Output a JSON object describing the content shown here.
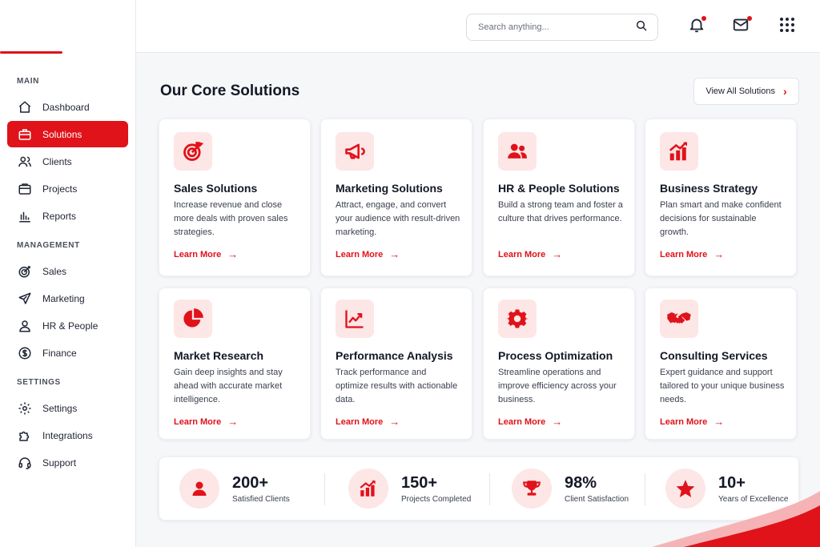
{
  "colors": {
    "accent": "#e0121a",
    "accent_soft": "#fde6e6"
  },
  "search": {
    "placeholder": "Search anything..."
  },
  "sidebar": {
    "sections": [
      {
        "title": "MAIN",
        "items": [
          {
            "label": "Dashboard",
            "icon": "home-icon"
          },
          {
            "label": "Solutions",
            "icon": "briefcase-icon",
            "active": true
          },
          {
            "label": "Clients",
            "icon": "users-icon"
          },
          {
            "label": "Projects",
            "icon": "folder-icon"
          },
          {
            "label": "Reports",
            "icon": "bar-chart-icon"
          }
        ]
      },
      {
        "title": "MANAGEMENT",
        "items": [
          {
            "label": "Sales",
            "icon": "target-icon"
          },
          {
            "label": "Marketing",
            "icon": "send-icon"
          },
          {
            "label": "HR & People",
            "icon": "user-icon"
          },
          {
            "label": "Finance",
            "icon": "dollar-icon"
          }
        ]
      },
      {
        "title": "SETTINGS",
        "items": [
          {
            "label": "Settings",
            "icon": "gear-icon"
          },
          {
            "label": "Integrations",
            "icon": "puzzle-icon"
          },
          {
            "label": "Support",
            "icon": "headset-icon"
          }
        ]
      }
    ]
  },
  "main": {
    "title": "Our Core Solutions",
    "view_all": "View All Solutions",
    "learn_more": "Learn More",
    "cards": [
      {
        "title": "Sales Solutions",
        "desc": "Increase revenue and close more deals with proven sales strategies.",
        "icon": "target-icon"
      },
      {
        "title": "Marketing Solutions",
        "desc": "Attract, engage, and convert your audience with result-driven marketing.",
        "icon": "megaphone-icon"
      },
      {
        "title": "HR & People Solutions",
        "desc": "Build a strong team and foster a culture that drives performance.",
        "icon": "people-icon"
      },
      {
        "title": "Business Strategy",
        "desc": "Plan smart and make confident decisions for sustainable growth.",
        "icon": "growth-chart-icon"
      },
      {
        "title": "Market Research",
        "desc": "Gain deep insights and stay ahead with accurate market intelligence.",
        "icon": "pie-chart-icon"
      },
      {
        "title": "Performance Analysis",
        "desc": "Track performance and optimize results with actionable data.",
        "icon": "line-chart-icon"
      },
      {
        "title": "Process Optimization",
        "desc": "Streamline operations and improve efficiency across your business.",
        "icon": "gear-icon"
      },
      {
        "title": "Consulting Services",
        "desc": "Expert guidance and support tailored to your unique business needs.",
        "icon": "handshake-icon"
      }
    ]
  },
  "stats": [
    {
      "value": "200+",
      "label": "Satisfied Clients",
      "icon": "user-icon"
    },
    {
      "value": "150+",
      "label": "Projects Completed",
      "icon": "growth-chart-icon"
    },
    {
      "value": "98%",
      "label": "Client Satisfaction",
      "icon": "trophy-icon"
    },
    {
      "value": "10+",
      "label": "Years of Excellence",
      "icon": "star-icon"
    }
  ]
}
